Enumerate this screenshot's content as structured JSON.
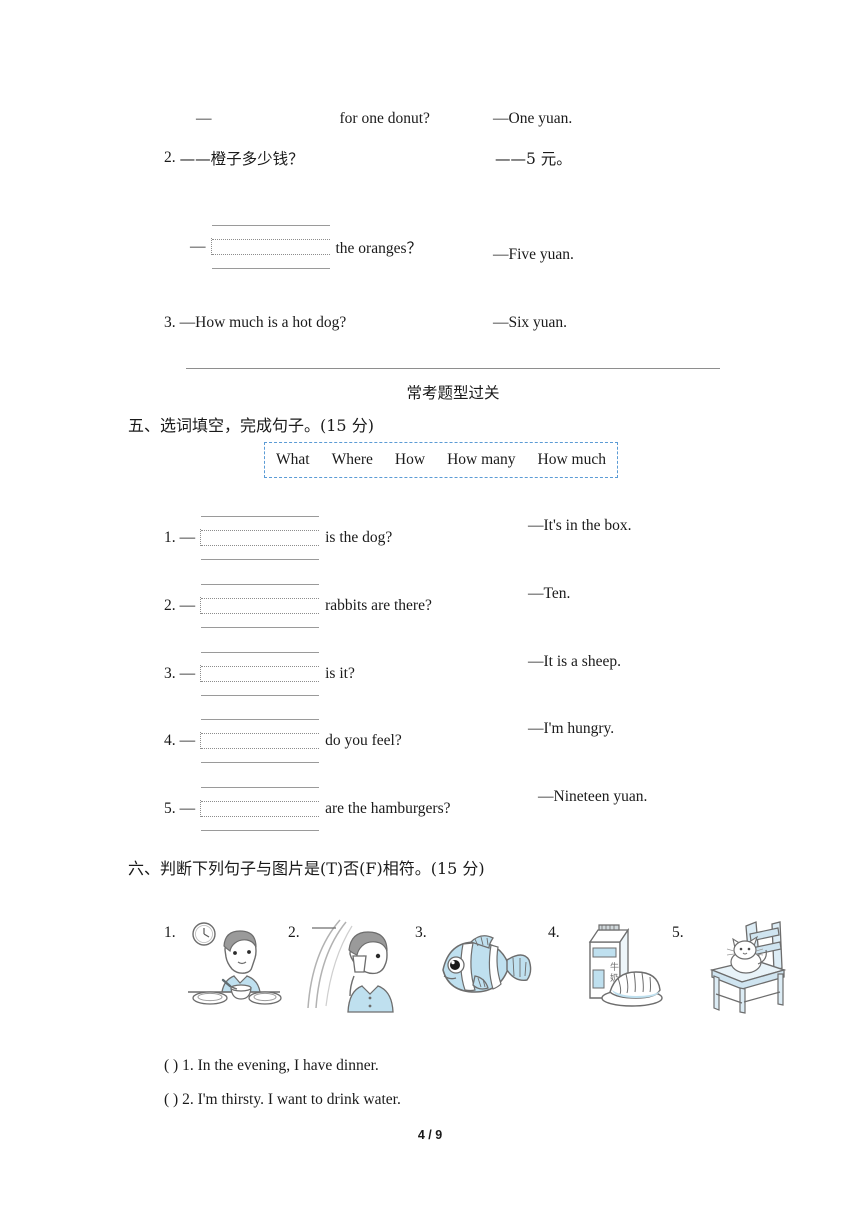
{
  "page": {
    "footer": "4 / 9",
    "accent_blue": "#5b9bd5",
    "line_gray": "#9a9a9a"
  },
  "top_section": {
    "item1_continuation": {
      "dash": "—",
      "tail": "for one donut?",
      "answer": "—One yuan."
    },
    "item2": {
      "number": "2.",
      "prompt_cn": "——橙子多少钱？",
      "answer_cn": "——5 元。",
      "dash": "—",
      "tail": "the oranges？",
      "answer_en": "—Five yuan."
    },
    "item3": {
      "number": "3.",
      "question": "—How much is a hot dog?",
      "answer": "—Six yuan."
    }
  },
  "banner": {
    "title": "常考题型过关"
  },
  "section_five": {
    "heading": "五、选词填空，完成句子。(15 分)",
    "word_bank": [
      "What",
      "Where",
      "How",
      "How many",
      "How much"
    ],
    "items": [
      {
        "number": "1.",
        "dash": "—",
        "tail": "is the dog?",
        "answer": "—It's in the box."
      },
      {
        "number": "2.",
        "dash": "—",
        "tail": "rabbits are there?",
        "answer": "—Ten."
      },
      {
        "number": "3.",
        "dash": "—",
        "tail": "is it?",
        "answer": "—It is a sheep."
      },
      {
        "number": "4.",
        "dash": "—",
        "tail": "do you feel?",
        "answer": "—I'm hungry."
      },
      {
        "number": "5.",
        "dash": "—",
        "tail": "are the hamburgers?",
        "answer": "—Nineteen yuan."
      }
    ]
  },
  "section_six": {
    "heading": "六、判断下列句子与图片是(T)否(F)相符。(15 分)",
    "pictures": [
      {
        "label": "1.",
        "icon": "boy-eating-dinner-with-clock-picture"
      },
      {
        "label": "2.",
        "icon": "boy-drinking-picture"
      },
      {
        "label": "3.",
        "icon": "fish-picture"
      },
      {
        "label": "4.",
        "icon": "milk-carton-and-bread-picture"
      },
      {
        "label": "5.",
        "icon": "cat-on-chair-picture"
      }
    ],
    "statements": [
      {
        "paren": "(        )",
        "text": "1. In the evening, I have dinner."
      },
      {
        "paren": "(        )",
        "text": "2. I'm thirsty. I want to drink water."
      }
    ]
  }
}
